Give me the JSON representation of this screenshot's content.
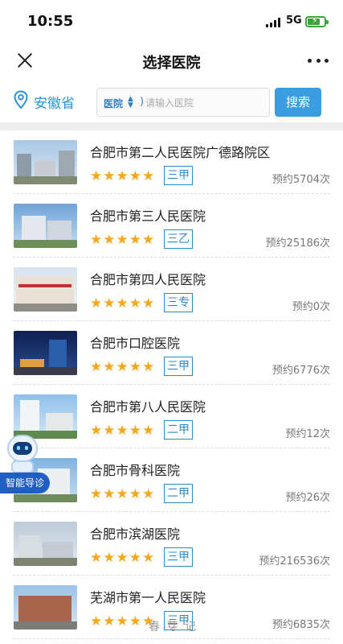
{
  "status_bar": {
    "time": "10:55",
    "network": "5G"
  },
  "nav": {
    "title": "选择医院"
  },
  "location": {
    "province": "安徽省"
  },
  "search": {
    "type_label": "医院",
    "separator": ")",
    "placeholder": "请输入医院",
    "button_label": "搜索"
  },
  "stars_glyph": "★★★★★",
  "hospitals": [
    {
      "name": "合肥市第二人民医院广德路院区",
      "grade": "三甲",
      "count": "预约5704次"
    },
    {
      "name": "合肥市第三人民医院",
      "grade": "三乙",
      "count": "预约25186次"
    },
    {
      "name": "合肥市第四人民医院",
      "grade": "三专",
      "count": "预约0次"
    },
    {
      "name": "合肥市口腔医院",
      "grade": "三甲",
      "count": "预约6776次"
    },
    {
      "name": "合肥市第八人民医院",
      "grade": "二甲",
      "count": "预约12次"
    },
    {
      "name": "合肥市骨科医院",
      "grade": "二甲",
      "count": "预约26次"
    },
    {
      "name": "合肥市滨湖医院",
      "grade": "三甲",
      "count": "预约216536次"
    },
    {
      "name": "芜湖市第一人民医院",
      "grade": "三甲",
      "count": "预约6835次"
    }
  ],
  "assistant": {
    "label": "智能导诊"
  },
  "watermark": "春 芽 记",
  "colors": {
    "accent": "#3a9de0",
    "star": "#f4a81f",
    "grade_border": "#2b8ac8",
    "assistant": "#1f5fc4"
  }
}
